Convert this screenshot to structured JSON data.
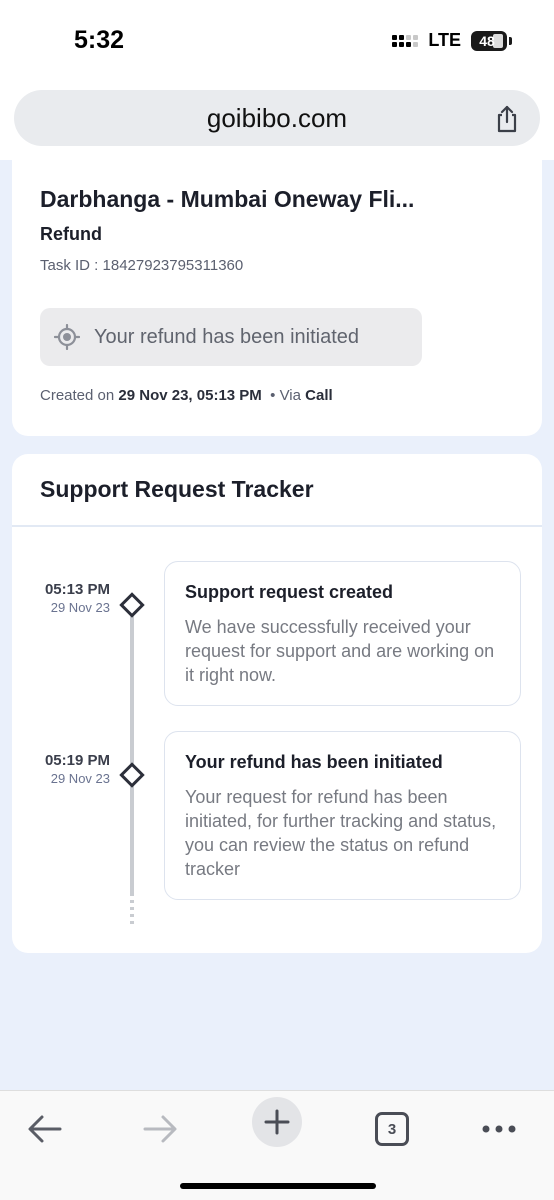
{
  "status_bar": {
    "time": "5:32",
    "network": "LTE",
    "battery": "48"
  },
  "browser": {
    "url": "goibibo.com",
    "share_icon": "share-icon",
    "tab_count": "3",
    "nav_icons": [
      "back-arrow-icon",
      "forward-arrow-icon",
      "new-tab-icon",
      "tab-switcher-icon",
      "more-icon"
    ]
  },
  "task_card": {
    "title": "Darbhanga - Mumbai Oneway Fli...",
    "subtitle": "Refund",
    "task_id": "Task ID : 18427923795311360",
    "status_icon": "target-icon",
    "status_text": "Your refund has been initiated",
    "created_prefix": "Created on",
    "created_date": "29 Nov 23, 05:13 PM",
    "via_prefix": "• Via",
    "via_value": "Call"
  },
  "tracker": {
    "title": "Support Request Tracker",
    "events": [
      {
        "time": "05:13 PM",
        "date": "29 Nov 23",
        "heading": "Support request created",
        "body": "We have successfully received your request for support and are working on it right now."
      },
      {
        "time": "05:19 PM",
        "date": "29 Nov 23",
        "heading": "Your refund has been initiated",
        "body": "Your request for refund has been initiated, for further tracking and status, you can review the status on refund tracker"
      }
    ]
  },
  "colors": {
    "page_background": "#eaf0fb",
    "card": "#ffffff",
    "text_primary": "#1c1f2a",
    "text_muted": "#777a82",
    "date_accent": "#6a7390"
  }
}
